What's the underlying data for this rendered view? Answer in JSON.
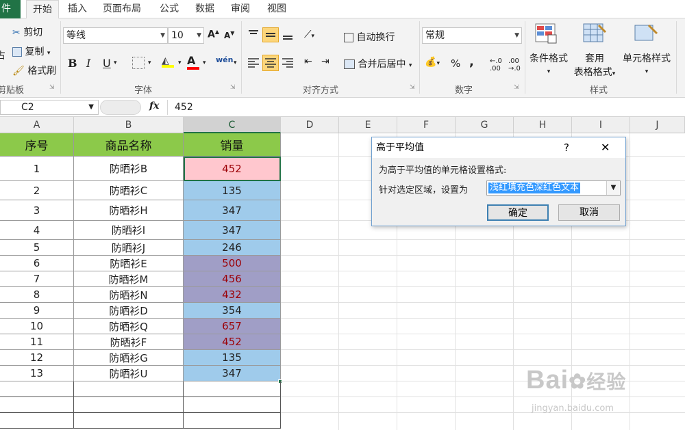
{
  "tabs": [
    "件",
    "开始",
    "插入",
    "页面布局",
    "公式",
    "数据",
    "审阅",
    "视图"
  ],
  "clipboard": {
    "cut": "剪切",
    "copy": "复制",
    "format_painter": "格式刷",
    "paste_partial": "占",
    "group": "剪贴板"
  },
  "font": {
    "name": "等线",
    "size": "10",
    "group": "字体",
    "bold": "B",
    "italic": "I",
    "underline": "U",
    "font_color_letter": "A",
    "phonetic": "wén"
  },
  "alignment": {
    "wrap": "自动换行",
    "merge": "合并后居中",
    "group": "对齐方式"
  },
  "number": {
    "format": "常规",
    "percent": "%",
    "comma": ",",
    "group": "数字"
  },
  "styles": {
    "conditional": "条件格式",
    "table_line1": "套用",
    "table_line2": "表格格式",
    "cell": "单元格样式",
    "group": "样式"
  },
  "formula_bar": {
    "name_box": "C2",
    "fx": "fx",
    "value": "452"
  },
  "columns": [
    "A",
    "B",
    "C",
    "D",
    "E",
    "F",
    "G",
    "H",
    "I",
    "J"
  ],
  "headers": {
    "a": "序号",
    "b": "商品名称",
    "c": "销量"
  },
  "rows": [
    {
      "a": "1",
      "b": "防晒衫B",
      "c": "452"
    },
    {
      "a": "2",
      "b": "防晒衫C",
      "c": "135"
    },
    {
      "a": "3",
      "b": "防晒衫H",
      "c": "347"
    },
    {
      "a": "4",
      "b": "防晒衫I",
      "c": "347"
    },
    {
      "a": "5",
      "b": "防晒衫J",
      "c": "246"
    },
    {
      "a": "6",
      "b": "防晒衫E",
      "c": "500"
    },
    {
      "a": "7",
      "b": "防晒衫M",
      "c": "456"
    },
    {
      "a": "8",
      "b": "防晒衫N",
      "c": "432"
    },
    {
      "a": "9",
      "b": "防晒衫D",
      "c": "354"
    },
    {
      "a": "10",
      "b": "防晒衫Q",
      "c": "657"
    },
    {
      "a": "11",
      "b": "防晒衫F",
      "c": "452"
    },
    {
      "a": "12",
      "b": "防晒衫G",
      "c": "135"
    },
    {
      "a": "13",
      "b": "防晒衫U",
      "c": "347"
    }
  ],
  "dialog": {
    "title": "高于平均值",
    "help": "?",
    "close": "✕",
    "desc": "为高于平均值的单元格设置格式:",
    "label": "针对选定区域，设置为",
    "selected": "浅红填充色深红色文本",
    "ok": "确定",
    "cancel": "取消"
  },
  "watermark": {
    "brand": "Bai",
    "brand_suffix": "经验",
    "url": "jingyan.baidu.com"
  },
  "colors": {
    "excel_green": "#217346",
    "header_fill": "#8cc94a",
    "blue_fill": "#9fcbeb",
    "purple_fill": "#a09ec6",
    "pink_fill": "#ffc7ce",
    "dark_red_text": "#9c0006"
  }
}
